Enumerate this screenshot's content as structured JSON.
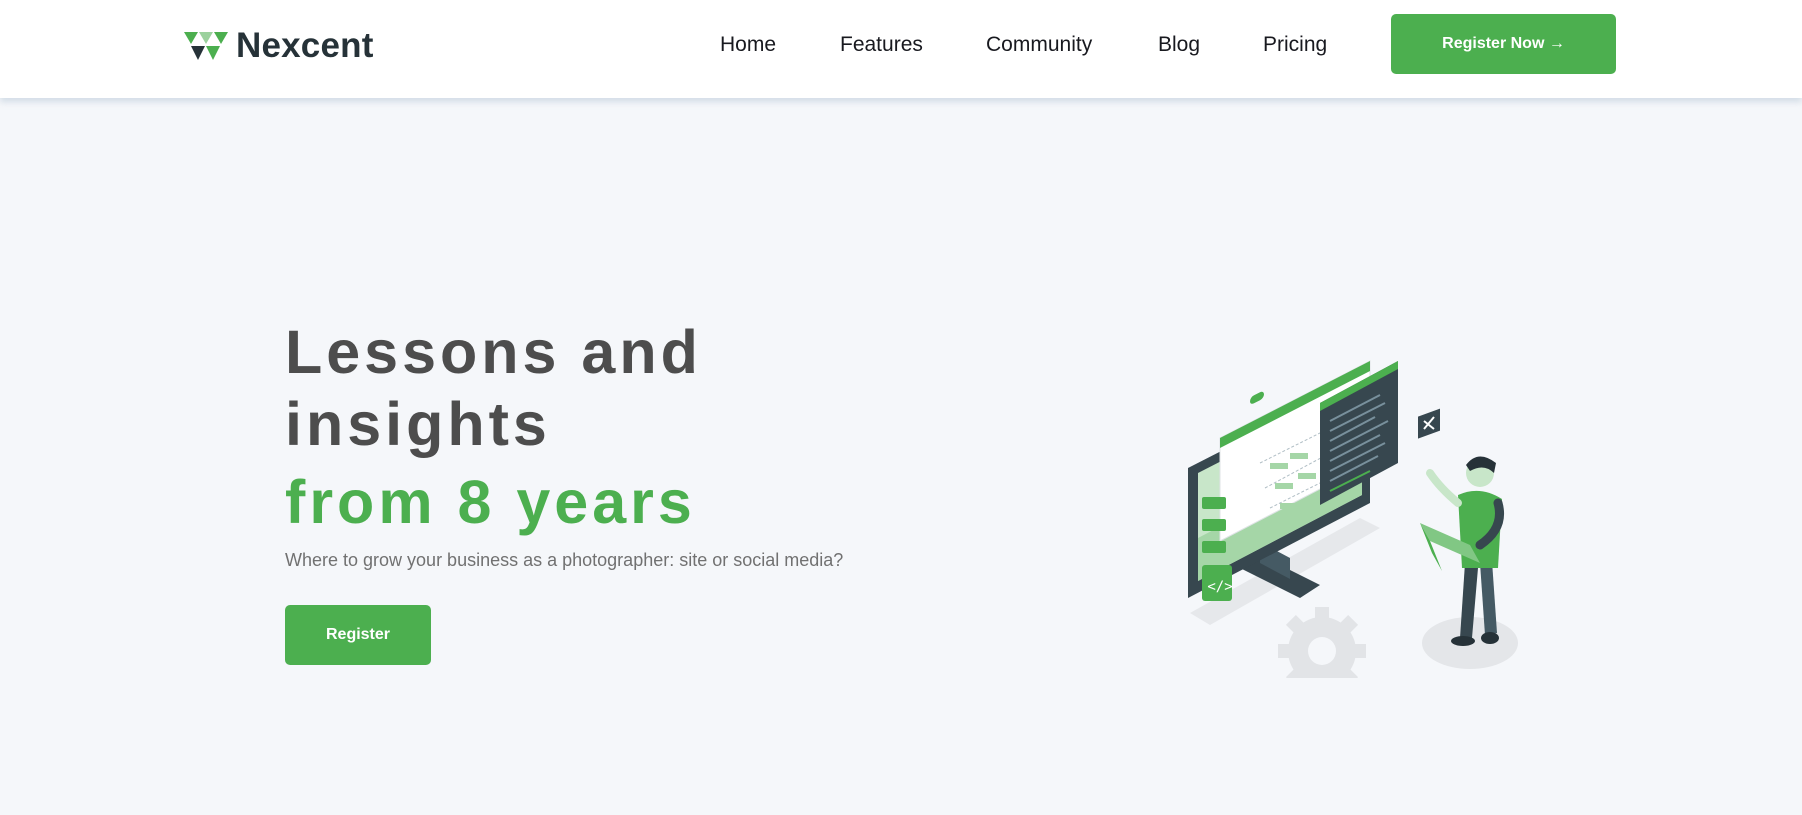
{
  "brand": {
    "name": "Nexcent",
    "logo_icon": "triangle-logo-icon"
  },
  "nav": {
    "links": [
      {
        "label": "Home"
      },
      {
        "label": "Features"
      },
      {
        "label": "Community"
      },
      {
        "label": "Blog"
      },
      {
        "label": "Pricing"
      }
    ],
    "cta_label": "Register Now →"
  },
  "hero": {
    "title": "Lessons and insights",
    "highlight": "from 8 years",
    "subtitle": "Where to grow your business as a photographer: site or social media?",
    "button_label": "Register",
    "illustration_icon": "developer-with-monitor-illustration"
  },
  "colors": {
    "primary": "#4CAF4F",
    "heading": "#4D4D4D",
    "body_text": "#717171",
    "background": "#F5F7FA",
    "dark": "#263238"
  }
}
